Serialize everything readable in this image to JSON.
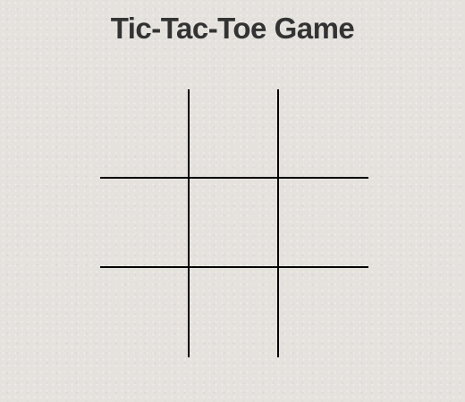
{
  "title": "Tic-Tac-Toe Game",
  "board": {
    "cells": [
      "",
      "",
      "",
      "",
      "",
      "",
      "",
      "",
      ""
    ]
  },
  "colors": {
    "background": "#e5e2de",
    "title": "#333333",
    "grid_lines": "#000000"
  }
}
